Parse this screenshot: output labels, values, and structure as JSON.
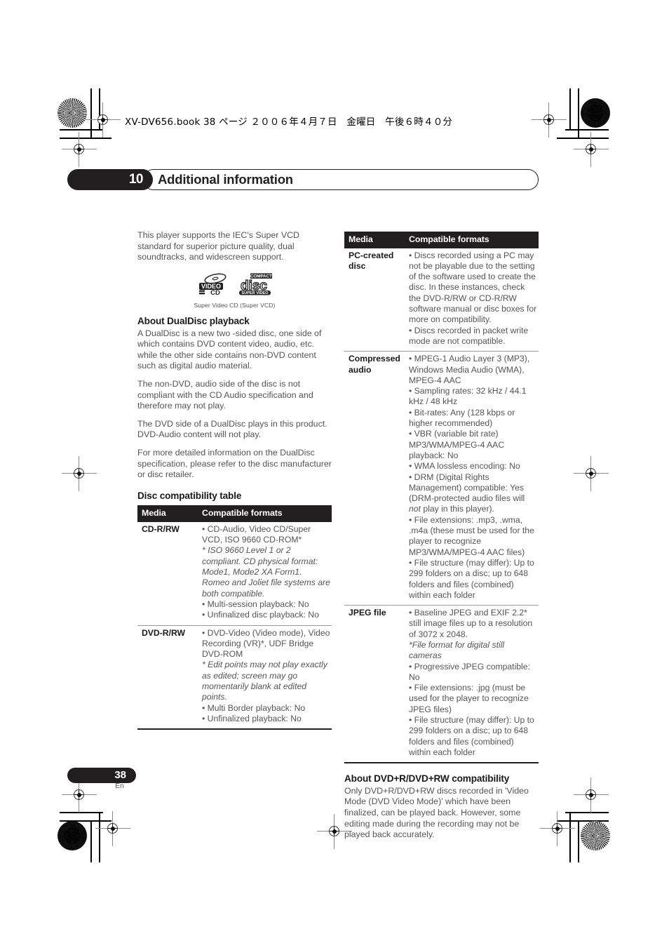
{
  "header": {
    "book_line": "XV-DV656.book  38 ページ  ２００６年４月７日　金曜日　午後６時４０分"
  },
  "chapter": {
    "number": "10",
    "title": "Additional information"
  },
  "left_column": {
    "intro_paragraph": "This player supports the IEC's Super VCD standard for superior picture quality, dual soundtracks, and widescreen support.",
    "logo_caption": "Super Video CD (Super VCD)",
    "logo_video_cd_top": "VIDEO",
    "logo_video_cd_bottom": "CD",
    "logo_disc_top": "COMPACT",
    "logo_disc_main": "disc",
    "logo_disc_bottom": "SUPER VIDEO",
    "dualdisc_heading": "About DualDisc playback",
    "dualdisc_paragraphs": [
      "A DualDisc is a new two -sided disc, one side of which contains DVD content video, audio, etc. while the other side contains non-DVD content such as digital audio material.",
      "The non-DVD, audio side of the disc is not compliant with the CD Audio specification and therefore may not play.",
      "The DVD side of a DualDisc plays in this product. DVD-Audio content will not play.",
      "For more detailed information on the DualDisc specification, please refer to the disc manufacturer or disc retailer."
    ],
    "table_heading": "Disc compatibility table",
    "table": {
      "columns": [
        "Media",
        "Compatible formats"
      ],
      "rows": [
        {
          "media": "CD-R/RW",
          "lines": [
            {
              "text": "• CD-Audio, Video CD/Super VCD, ISO 9660 CD-ROM*",
              "style": "normal"
            },
            {
              "text": "* ISO 9660 Level 1 or 2 compliant. CD physical format: Mode1, Mode2 XA Form1. Romeo and Joliet file systems are both compatible.",
              "style": "italic"
            },
            {
              "text": "• Multi-session playback: No",
              "style": "normal"
            },
            {
              "text": "• Unfinalized disc playback: No",
              "style": "normal"
            }
          ]
        },
        {
          "media": "DVD-R/RW",
          "lines": [
            {
              "text": "• DVD-Video (Video mode), Video Recording (VR)*, UDF Bridge DVD-ROM",
              "style": "normal"
            },
            {
              "text": "* Edit points may not play exactly as edited; screen may go momentarily blank at edited points.",
              "style": "italic"
            },
            {
              "text": "• Multi Border playback: No",
              "style": "normal"
            },
            {
              "text": "• Unfinalized playback: No",
              "style": "normal"
            }
          ]
        }
      ]
    }
  },
  "right_column": {
    "table": {
      "columns": [
        "Media",
        "Compatible formats"
      ],
      "rows": [
        {
          "media": "PC-created disc",
          "lines": [
            {
              "text": "• Discs recorded using a PC may not be playable due to the setting of the software used to create the disc. In these instances, check the DVD-R/RW or CD-R/RW software manual or disc boxes for more on compatibility.",
              "style": "normal"
            },
            {
              "text": "• Discs recorded in packet write mode are not compatible.",
              "style": "normal"
            }
          ]
        },
        {
          "media": "Compressed audio",
          "lines": [
            {
              "text": "• MPEG-1 Audio Layer 3 (MP3), Windows Media Audio (WMA), MPEG-4 AAC",
              "style": "normal"
            },
            {
              "text": "• Sampling rates: 32 kHz / 44.1 kHz / 48 kHz",
              "style": "normal"
            },
            {
              "text": "• Bit-rates: Any (128 kbps or higher recommended)",
              "style": "normal"
            },
            {
              "text": "• VBR (variable bit rate) MP3/WMA/MPEG-4 AAC playback: No",
              "style": "normal"
            },
            {
              "text": "• WMA lossless encoding: No",
              "style": "normal"
            },
            {
              "text": "• DRM (Digital Rights Management) compatible: Yes (DRM-protected audio files will not play in this player).",
              "style": "normal",
              "italic_word": "not"
            },
            {
              "text": "• File extensions: .mp3, .wma, .m4a (these must be used for the player to recognize MP3/WMA/MPEG-4 AAC files)",
              "style": "normal"
            },
            {
              "text": "• File structure (may differ): Up to 299 folders on a disc; up to 648 folders and files (combined) within each folder",
              "style": "normal"
            }
          ]
        },
        {
          "media": "JPEG file",
          "lines": [
            {
              "text": "• Baseline JPEG and EXIF 2.2* still image files up to a resolution of 3072 x 2048.",
              "style": "normal"
            },
            {
              "text": "*File format for digital still cameras",
              "style": "italic"
            },
            {
              "text": "• Progressive JPEG compatible: No",
              "style": "normal"
            },
            {
              "text": "• File extensions: .jpg (must be used for the player to recognize JPEG files)",
              "style": "normal"
            },
            {
              "text": "• File structure (may differ): Up to 299 folders on a disc; up to 648 folders and files (combined) within each folder",
              "style": "normal"
            }
          ]
        }
      ]
    },
    "dvdplus_heading": "About DVD+R/DVD+RW compatibility",
    "dvdplus_paragraph": "Only DVD+R/DVD+RW discs recorded in 'Video Mode (DVD Video Mode)' which have been finalized, can be played back. However, some editing made during the recording may not be played back accurately."
  },
  "footer": {
    "page_number": "38",
    "language": "En"
  },
  "colors": {
    "ink_black": "#231f20",
    "body_gray": "#555555",
    "rule_gray": "#9a9a9a"
  }
}
